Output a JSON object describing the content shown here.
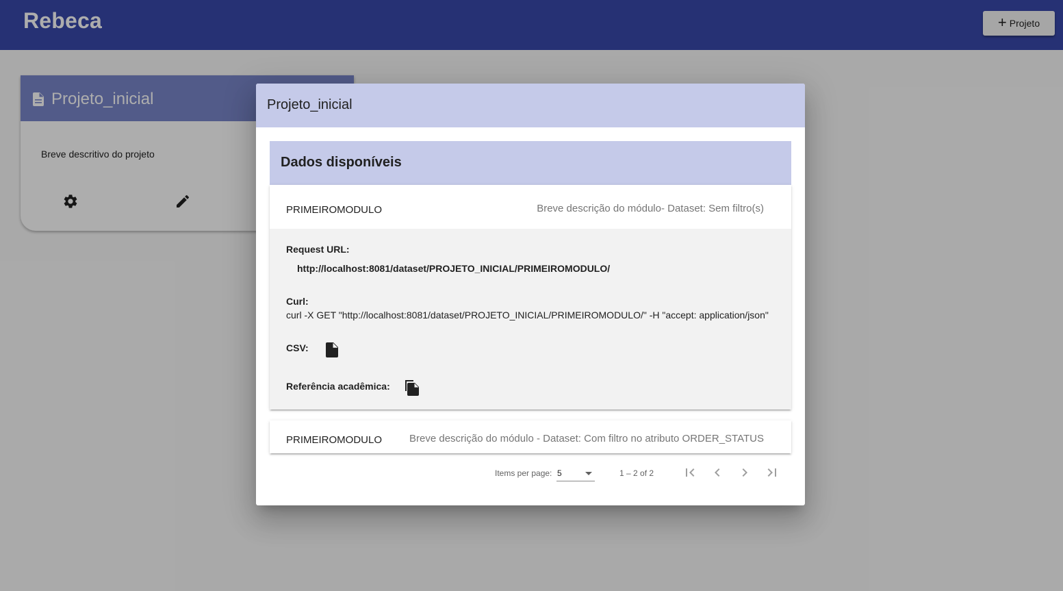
{
  "app": {
    "title": "Rebeca",
    "new_project_label": "Projeto"
  },
  "project_card": {
    "title": "Projeto_inicial",
    "description": "Breve descritivo do projeto"
  },
  "dialog": {
    "title": "Projeto_inicial",
    "section_title": "Dados disponíveis",
    "datasets": [
      {
        "name": "PRIMEIROMODULO",
        "description": "Breve descrição do módulo- Dataset: Sem filtro(s)",
        "expanded": true,
        "request_url_label": "Request URL:",
        "request_url": "http://localhost:8081/dataset/PROJETO_INICIAL/PRIMEIROMODULO/",
        "curl_label": "Curl:",
        "curl": "curl -X GET \"http://localhost:8081/dataset/PROJETO_INICIAL/PRIMEIROMODULO/\" -H \"accept: application/json\"",
        "csv_label": "CSV:",
        "reference_label": "Referência acadêmica:"
      },
      {
        "name": "PRIMEIROMODULO",
        "description": "Breve descrição do módulo - Dataset: Com filtro no atributo ORDER_STATUS",
        "expanded": false
      }
    ],
    "paginator": {
      "items_per_page_label": "Items per page:",
      "page_size": "5",
      "range_label": "1 – 2 of 2"
    }
  },
  "colors": {
    "toolbar": "#3949ab",
    "card_header": "#7986cb",
    "dialog_header": "#c5cae9",
    "panel_body": "#f2f2f2"
  }
}
